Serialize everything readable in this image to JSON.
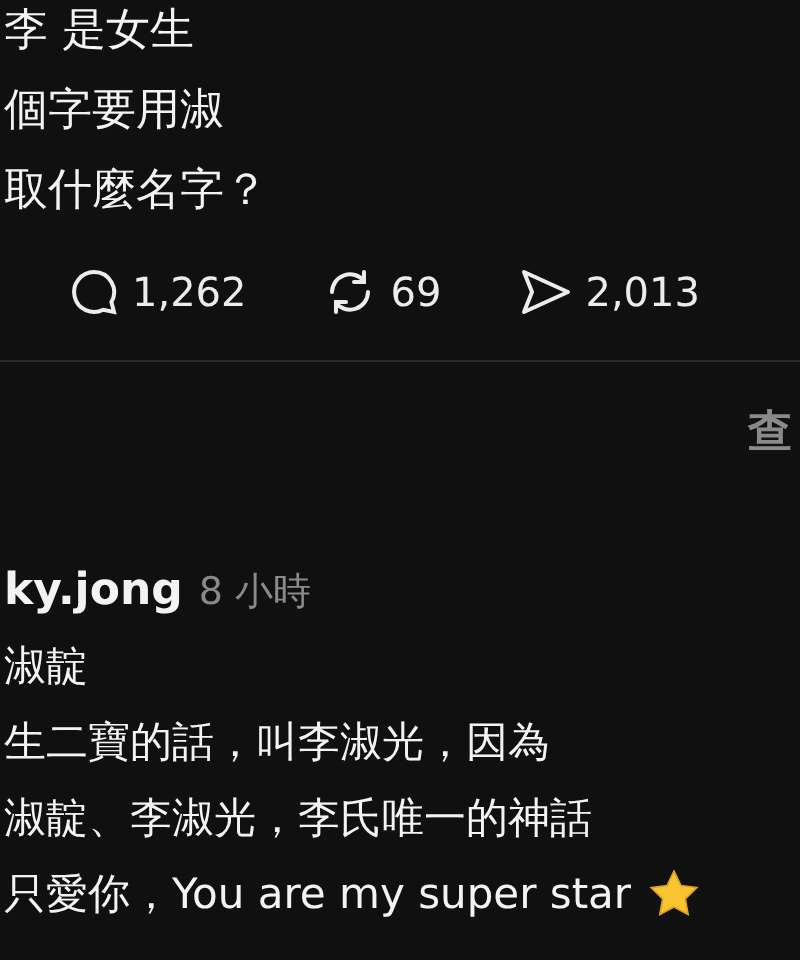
{
  "post": {
    "lines": [
      "李 是女生",
      "個字要用淑",
      "取什麼名字？"
    ],
    "actions": [
      {
        "kind": "comment",
        "count": "1,262"
      },
      {
        "kind": "repost",
        "count": "69"
      },
      {
        "kind": "share",
        "count": "2,013"
      }
    ]
  },
  "view_link": "查",
  "reply": {
    "username": "ky.jong",
    "time": "8 小時",
    "lines": [
      "淑靛",
      "生二寶的話，叫李淑光，因為",
      "淑靛、李淑光，李氏唯一的神話",
      "只愛你，You are my super star"
    ],
    "end_icon": {
      "kind": "star"
    }
  }
}
